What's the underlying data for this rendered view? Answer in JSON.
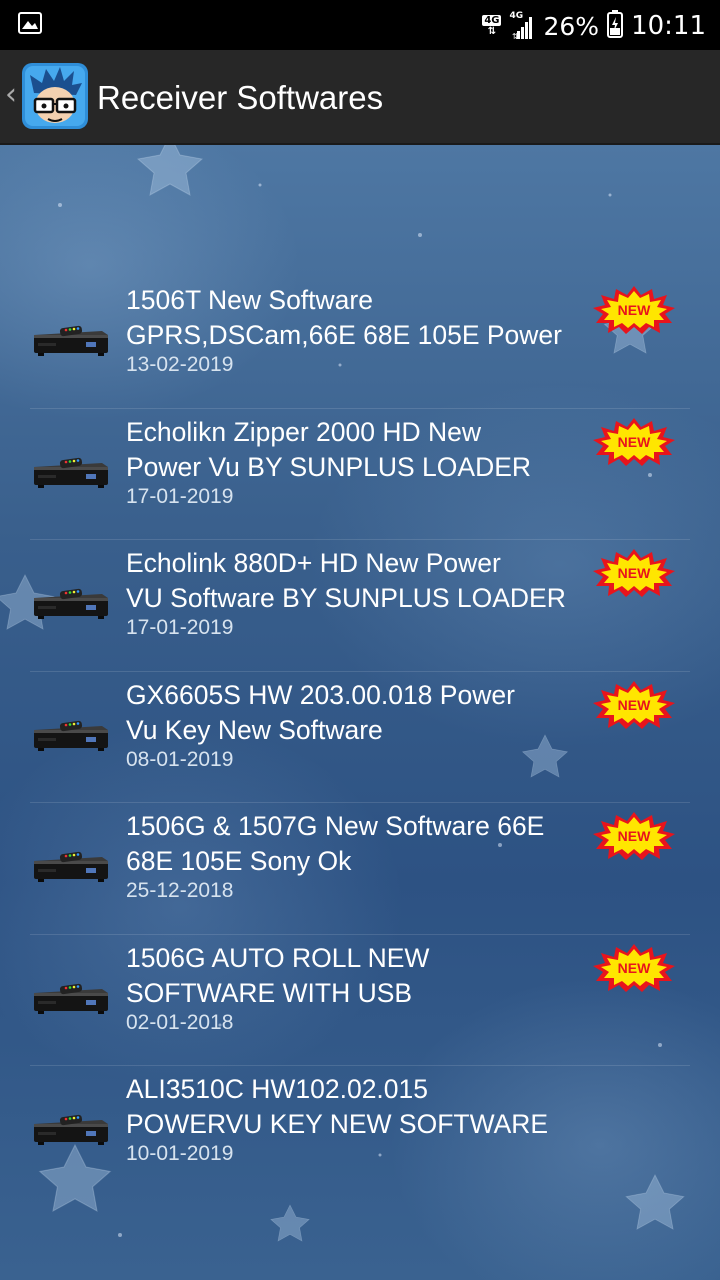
{
  "status_bar": {
    "gallery_icon": "image-icon",
    "network_badge_1": "4G",
    "network_badge_2": "4G",
    "battery_percent": "26%",
    "time": "10:11"
  },
  "app_bar": {
    "title": "Receiver Softwares",
    "back_icon": "chevron-left-icon",
    "logo_icon": "app-logo-icon"
  },
  "colors": {
    "app_bar_bg": "#272727",
    "content_bg": "#3a6290",
    "badge_yellow": "#ffe600",
    "badge_red": "#e8141c"
  },
  "new_badge_label": "NEW",
  "items": [
    {
      "title": "1506T New Software\nGPRS,DSCam,66E 68E 105E Power",
      "date": "13-02-2019"
    },
    {
      "title": "Echolikn Zipper 2000 HD New\nPower Vu  BY SUNPLUS LOADER",
      "date": "17-01-2019"
    },
    {
      "title": "Echolink 880D+ HD  New Power\nVU Software BY SUNPLUS LOADER",
      "date": "17-01-2019"
    },
    {
      "title": "GX6605S  HW 203.00.018 Power\nVu Key New Software",
      "date": "08-01-2019"
    },
    {
      "title": "1506G & 1507G New Software 66E\n68E 105E Sony Ok",
      "date": "25-12-2018"
    },
    {
      "title": "1506G AUTO ROLL NEW\nSOFTWARE WITH USB",
      "date": "02-01-2018"
    },
    {
      "title": "ALI3510C HW102.02.015\nPOWERVU KEY NEW SOFTWARE",
      "date": "10-01-2019"
    }
  ]
}
